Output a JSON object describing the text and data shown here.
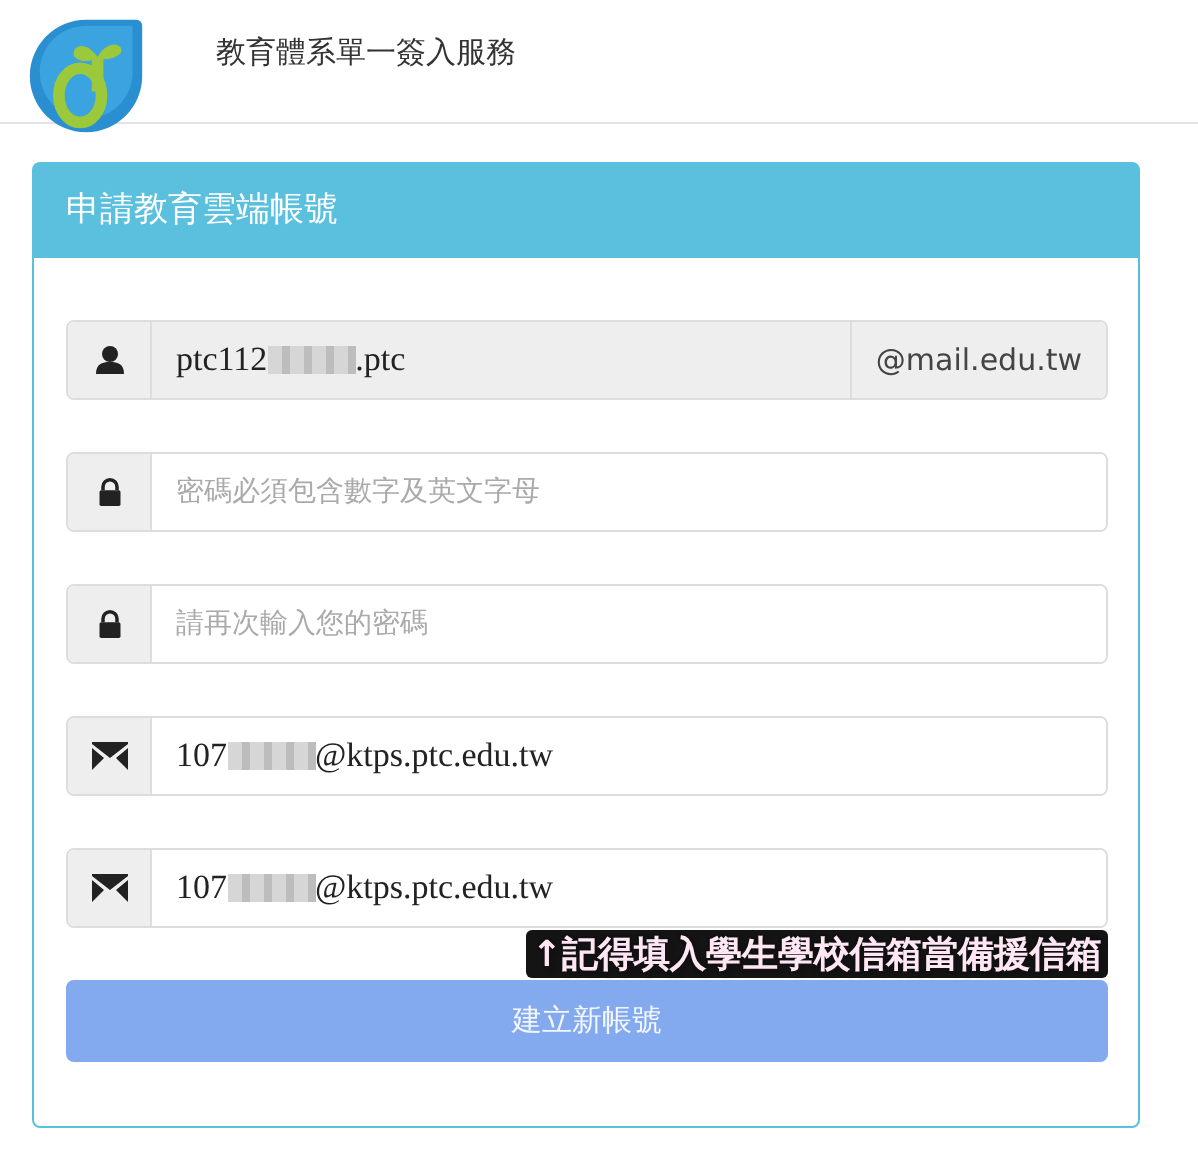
{
  "header": {
    "title": "教育體系單一簽入服務"
  },
  "panel": {
    "title": "申請教育雲端帳號",
    "fields": [
      {
        "kind": "account",
        "value_start": "ptc112",
        "value_end": ".ptc",
        "redacted": true,
        "suffix": "@mail.edu.tw"
      },
      {
        "kind": "password",
        "placeholder": "密碼必須包含數字及英文字母"
      },
      {
        "kind": "password",
        "placeholder": "請再次輸入您的密碼"
      },
      {
        "kind": "email",
        "value_start": "107",
        "value_end": "@ktps.ptc.edu.tw",
        "redacted": true
      },
      {
        "kind": "email",
        "value_start": "107",
        "value_end": "@ktps.ptc.edu.tw",
        "redacted": true
      }
    ],
    "annotation": "↑記得填入學生學校信箱當備援信箱",
    "submit": {
      "label": "建立新帳號",
      "disabled": true
    }
  }
}
